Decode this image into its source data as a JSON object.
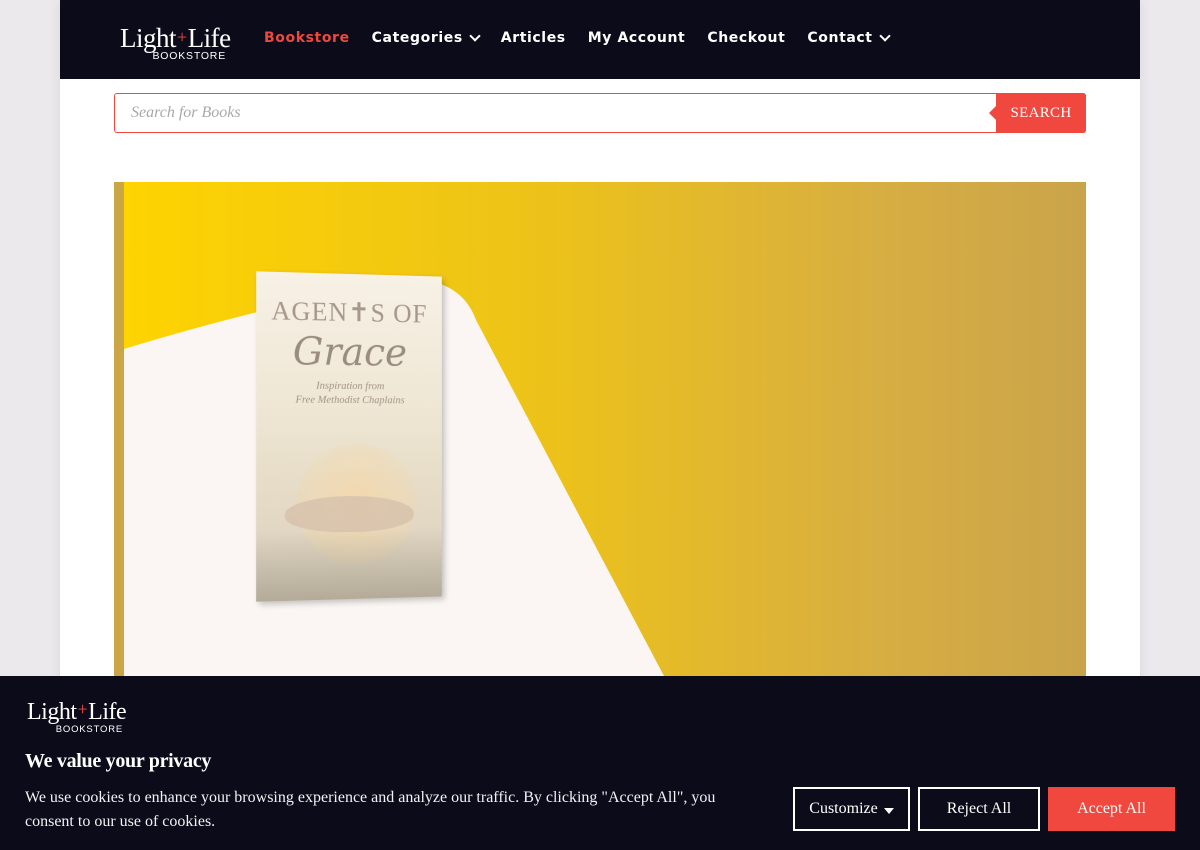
{
  "brand": {
    "name_left": "Light",
    "name_plus": "+",
    "name_right": "Life",
    "subtitle": "BOOKSTORE"
  },
  "nav": {
    "items": [
      {
        "label": "Bookstore",
        "active": true,
        "has_dropdown": false
      },
      {
        "label": "Categories",
        "active": false,
        "has_dropdown": true
      },
      {
        "label": "Articles",
        "active": false,
        "has_dropdown": false
      },
      {
        "label": "My Account",
        "active": false,
        "has_dropdown": false
      },
      {
        "label": "Checkout",
        "active": false,
        "has_dropdown": false
      },
      {
        "label": "Contact",
        "active": false,
        "has_dropdown": true
      }
    ]
  },
  "search": {
    "placeholder": "Search for Books",
    "value": "",
    "button_label": "SEARCH"
  },
  "hero": {
    "book": {
      "title_line1": "AGEN✝S OF",
      "title_line2": "Grace",
      "subtitle_line1": "Inspiration from",
      "subtitle_line2": "Free Methodist Chaplains"
    }
  },
  "cookie_banner": {
    "title": "We value your privacy",
    "text": "We use cookies to enhance your browsing experience and analyze our traffic. By clicking \"Accept All\", you consent to our use of cookies.",
    "customize_label": "Customize",
    "reject_label": "Reject All",
    "accept_label": "Accept All"
  },
  "colors": {
    "accent": "#f0483e",
    "navbar_bg": "#0c0b1a",
    "hero_yellow": "#fed400",
    "hero_gold": "#caa44a",
    "page_bg": "#ebe9ec"
  },
  "icons": [
    "chevron-down-icon",
    "caret-down-icon",
    "cross-icon"
  ]
}
